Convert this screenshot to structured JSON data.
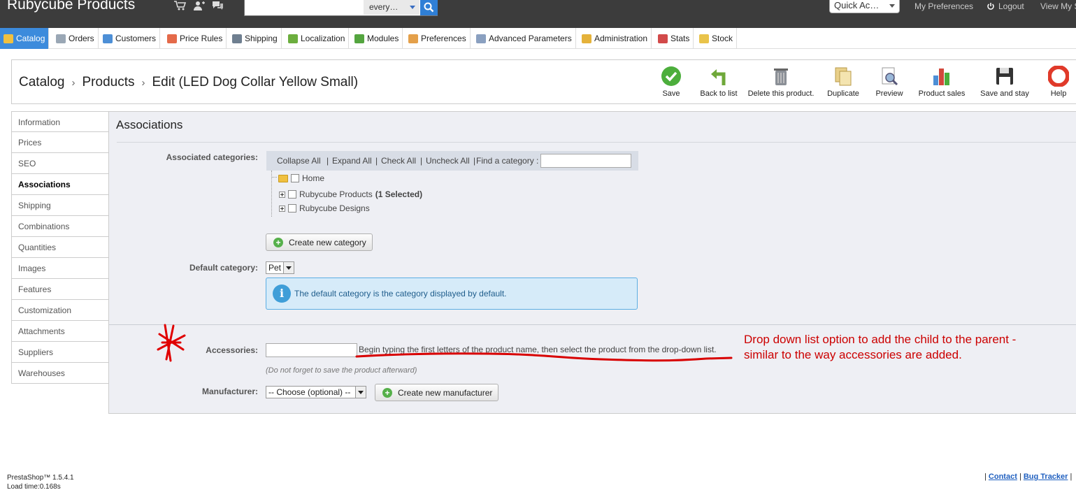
{
  "header": {
    "shop_name": "Rubycube Products",
    "search_value": "",
    "search_scope": "every…",
    "quick_access": "Quick Ac…",
    "my_preferences": "My Preferences",
    "logout": "Logout",
    "view_my_shop": "View My S"
  },
  "menu": [
    {
      "label": "Catalog",
      "icon": "catalog-icon",
      "color": "#f0c040"
    },
    {
      "label": "Orders",
      "icon": "cart-icon",
      "color": "#9aa7b5"
    },
    {
      "label": "Customers",
      "icon": "customers-icon",
      "color": "#4d8fd6"
    },
    {
      "label": "Price Rules",
      "icon": "price-rules-icon",
      "color": "#e46a4a"
    },
    {
      "label": "Shipping",
      "icon": "truck-icon",
      "color": "#6f7f90"
    },
    {
      "label": "Localization",
      "icon": "globe-icon",
      "color": "#6cae3e"
    },
    {
      "label": "Modules",
      "icon": "puzzle-icon",
      "color": "#54a53f"
    },
    {
      "label": "Preferences",
      "icon": "preferences-icon",
      "color": "#e4a04a"
    },
    {
      "label": "Advanced Parameters",
      "icon": "wrench-icon",
      "color": "#8aa0c0"
    },
    {
      "label": "Administration",
      "icon": "key-icon",
      "color": "#e5b23a"
    },
    {
      "label": "Stats",
      "icon": "stats-icon",
      "color": "#d24a4a"
    },
    {
      "label": "Stock",
      "icon": "stock-icon",
      "color": "#e9c34a"
    }
  ],
  "breadcrumb": {
    "level1": "Catalog",
    "level2": "Products",
    "level3": "Edit (LED Dog Collar Yellow Small)",
    "separator": "›"
  },
  "toolbar": [
    {
      "label": "Save",
      "icon": "save-check-icon",
      "color": "#4cae3c"
    },
    {
      "label": "Back to list",
      "icon": "back-arrow-icon",
      "color": "#6fa83a"
    },
    {
      "label": "Delete this product.",
      "icon": "trash-icon",
      "color": "#8a8f96"
    },
    {
      "label": "Duplicate",
      "icon": "duplicate-icon",
      "color": "#e9d08a"
    },
    {
      "label": "Preview",
      "icon": "preview-icon",
      "color": "#9ab8d8"
    },
    {
      "label": "Product sales",
      "icon": "sales-chart-icon",
      "color": "#d2483c"
    },
    {
      "label": "Save and stay",
      "icon": "floppy-icon",
      "color": "#333333"
    },
    {
      "label": "Help",
      "icon": "lifebuoy-icon",
      "color": "#e03a2a"
    }
  ],
  "tabs": [
    "Information",
    "Prices",
    "SEO",
    "Associations",
    "Shipping",
    "Combinations",
    "Quantities",
    "Images",
    "Features",
    "Customization",
    "Attachments",
    "Suppliers",
    "Warehouses"
  ],
  "selected_tab": "Associations",
  "panel": {
    "title": "Associations",
    "associated_categories_label": "Associated categories:",
    "tree_bar": {
      "collapse_all": "Collapse All",
      "expand_all": "Expand All",
      "check_all": "Check All",
      "uncheck_all": "Uncheck All",
      "find_category": "Find a category :",
      "sep": "|"
    },
    "tree": {
      "home": "Home",
      "rubycube_products": "Rubycube Products",
      "selected_count": "(1 Selected)",
      "rubycube_designs": "Rubycube Designs"
    },
    "create_category": "Create new category",
    "default_category_label": "Default category:",
    "default_category_value": "Pet",
    "info_text": "The default category is the category displayed by default.",
    "accessories_label": "Accessories:",
    "accessories_hint": "Begin typing the first letters of the product name, then select the product from the drop-down list.",
    "accessories_note": "(Do not forget to save the product afterward)",
    "manufacturer_label": "Manufacturer:",
    "manufacturer_value": "-- Choose (optional) --",
    "create_manufacturer": "Create new manufacturer"
  },
  "annotation": {
    "text": "Drop down list option to add the child to the parent - similar to the way accessories are added.",
    "color": "#cc0000"
  },
  "footer": {
    "version": "PrestaShop™ 1.5.4.1",
    "load_time": "Load time:0.168s",
    "contact": "Contact",
    "bug_tracker": "Bug Tracker",
    "pipe": "|"
  }
}
